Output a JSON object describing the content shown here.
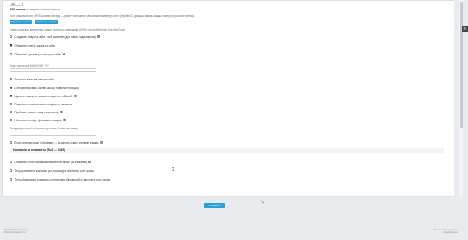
{
  "top_field": {
    "value": "200"
  },
  "rsh": {
    "label": "RSH-импорт:",
    "value": "последний ответ от запуска: —"
  },
  "cron_note": "Если у вас включен CRON-режим очереди — работу выполняет автоматически внутри cron (php bitrix24 дважды заказа (каждые минуты) прошлое время).",
  "buttons": {
    "run": "Запустить сейчас",
    "reset": "Сбросить очистки"
  },
  "hint_text": "Пакеты очереди выполнены, можно запустить отдельный CRON: php /path/to/cron.php bitrix24.sm",
  "options": [
    {
      "label": "Создавать лиды на сайте, если заказ нет (для новых лидов/сделок)",
      "checked": false,
      "help": true
    },
    {
      "label": "Обновлять статус заказа на сайте",
      "checked": true,
      "help": false
    },
    {
      "label": "Обновлять доставку и оплату на сайте",
      "checked": false,
      "help": true
    }
  ],
  "field_a": {
    "label": "Поле точности в Bitrix24 (UF_*)",
    "help": "?",
    "value": ""
  },
  "options2": [
    {
      "label": "Отвечать заказ как законченный",
      "checked": false,
      "help": false
    },
    {
      "label": "Синхронизировать состав заказа (товарные позиции)",
      "checked": true,
      "help": false
    },
    {
      "label": "Удалять товары из заказа, которых нет в Bitrix24",
      "checked": true,
      "help": true
    },
    {
      "label": "Разрешить сопоставление товаров по названию",
      "checked": false,
      "help": false
    },
    {
      "label": "Пробовать искать товар по артикулу",
      "checked": false,
      "help": true
    },
    {
      "label": "Не считать строку «Доставка» товаром",
      "checked": false,
      "help": true
    }
  ],
  "field_b": {
    "label": "Складка для расчёта/наличия доставки (товар-заглушка)",
    "value": ""
  },
  "option_last": {
    "label": "Если цена/на строке «Доставка» — зачислять сумму доставки в заказ",
    "checked": false,
    "help": true
  },
  "section": {
    "title": "Компании и реквизиты (B24 — CMS)"
  },
  "options3": [
    {
      "label": "Обновлять поле компания/реквизиты в заказе (из компании)",
      "checked": false,
      "help": true
    },
    {
      "label": "Текущ реквизиты компании (с/п-перевод) и заполнять поле заказа",
      "checked": false,
      "help": false
    },
    {
      "label": "Текущ банковские реквизиты (с/п-перевод-банковский) и заполнять поле заказа",
      "checked": false,
      "help": false
    }
  ],
  "save_label": "Сохранить",
  "side_tab_label": "☰",
  "footer": {
    "left_line1": "© 2022-2024 intec/sales.ru",
    "left_line2": "Bitrix24 API версия 7.2.7",
    "right_line1": "Техническая поддержка",
    "right_line2": "Документация"
  },
  "icons": {
    "help": "help-circle-icon",
    "resize": "resize-diagonal-icon",
    "cursor": "mouse-cursor-icon",
    "side_tab": "sidebar-toggle-icon"
  },
  "colors": {
    "accent": "#2a9fd6",
    "page_bg": "#e9ecef",
    "card_bg": "#ffffff"
  }
}
